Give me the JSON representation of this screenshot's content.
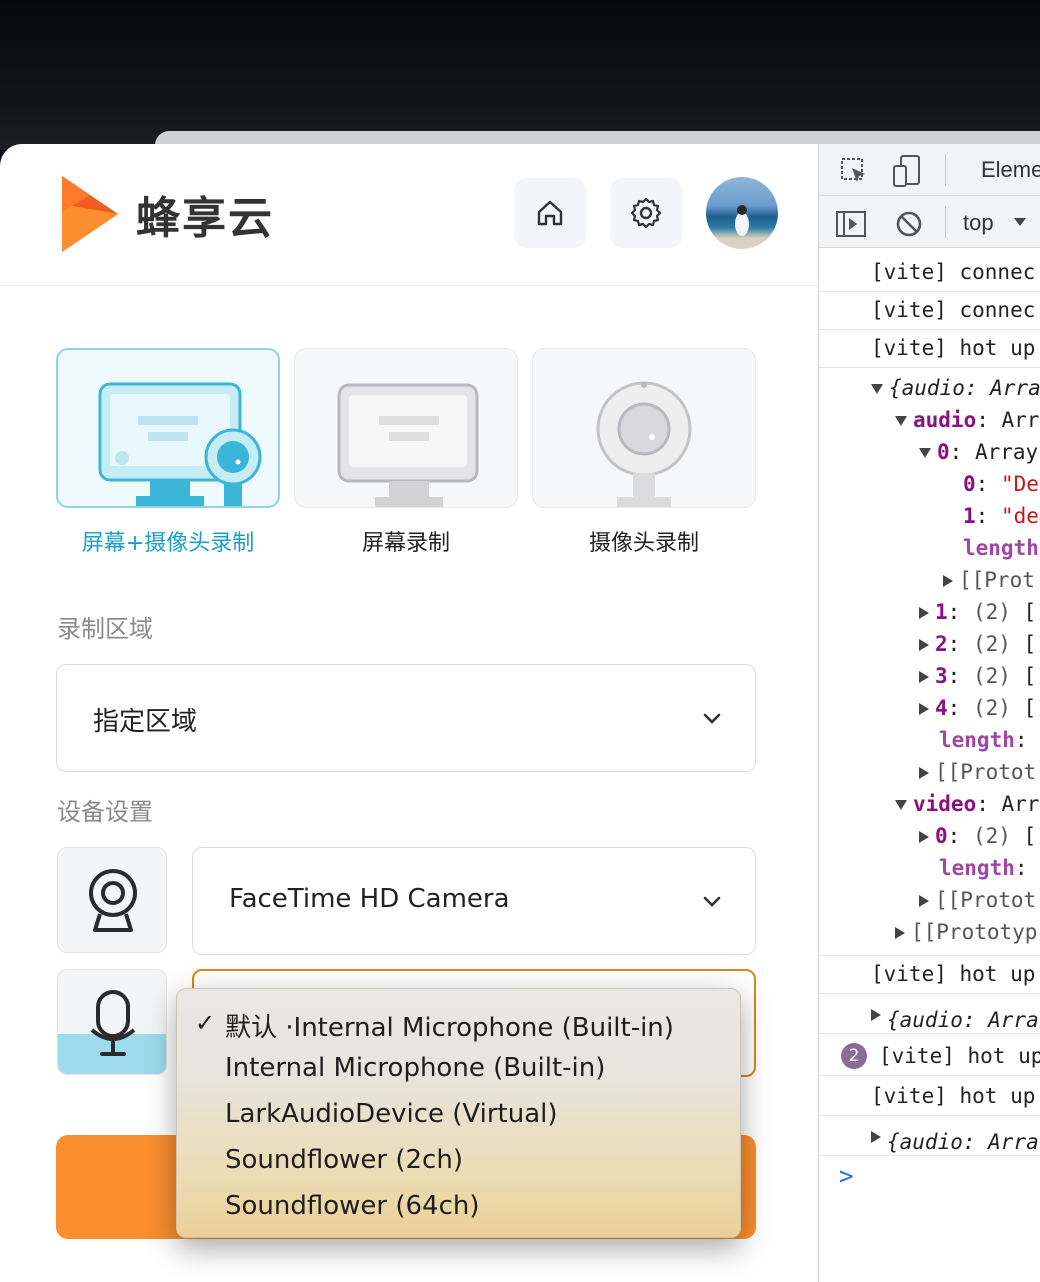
{
  "app": {
    "brand": "蜂享云",
    "mode_cards": [
      {
        "label": "屏幕+摄像头录制",
        "active": true
      },
      {
        "label": "屏幕录制",
        "active": false
      },
      {
        "label": "摄像头录制",
        "active": false
      }
    ],
    "region_section": {
      "title": "录制区域",
      "value": "指定区域"
    },
    "device_section": {
      "title": "设备设置",
      "camera_value": "FaceTime HD Camera"
    },
    "mic_dropdown": {
      "options": [
        "默认 ·Internal Microphone (Built-in)",
        "Internal Microphone (Built-in)",
        "LarkAudioDevice (Virtual)",
        "Soundflower (2ch)",
        "Soundflower (64ch)"
      ],
      "selected_index": 0
    },
    "colors": {
      "accent": "#1aa0c6",
      "primary_button": "#fb8e2e",
      "focus_border": "#d48a14"
    }
  },
  "devtools": {
    "tab_label": "Eleme",
    "context": "top",
    "log_rows": {
      "r1": "[vite] connec",
      "r2": "[vite] connec",
      "r3": "[vite] hot up",
      "r4": "[vite] hot up",
      "r5": "{audio: Arra",
      "r6": "[vite] hot up",
      "r7": "[vite] hot up",
      "r8": "{audio: Arra"
    },
    "repeat_badge": "2",
    "tree": {
      "root": "{audio: Arra",
      "audio_key": "audio",
      "audio_val": "Arr",
      "item0_key": "0",
      "item0_val": "Array",
      "s0_key": "0",
      "s0_val": "\"De",
      "s1_key": "1",
      "s1_val": "\"de",
      "len1": "length",
      "proto1": "[[Prot",
      "i1": "1",
      "i2": "2",
      "i3": "3",
      "i4": "4",
      "count": "(2)",
      "bracket": "[",
      "len2": "length",
      "proto2": "[[Protot",
      "video_key": "video",
      "video_val": "Arr",
      "v0": "0",
      "len3": "length",
      "proto3": "[[Protot",
      "proto4": "[[Prototyp"
    },
    "prompt": ">"
  }
}
